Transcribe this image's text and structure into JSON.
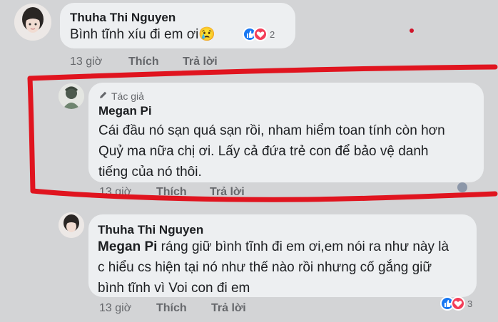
{
  "comments": [
    {
      "author": "Thuha Thi Nguyen",
      "text": "Bình tĩnh xíu đi em ơi😢",
      "reaction_count": "2",
      "time": "13 giờ",
      "like_label": "Thích",
      "reply_label": "Trả lời"
    },
    {
      "badge": "Tác giả",
      "author": "Megan Pi",
      "lines": [
        "Cái đầu nó sạn quá sạn rồi, nham hiểm toan tính còn hơn",
        "Quỷ ma nữa chị ơi. Lấy cả đứa trẻ con để bảo vệ danh",
        "tiếng của nó thôi."
      ],
      "time": "13 giờ",
      "like_label": "Thích",
      "reply_label": "Trả lời"
    },
    {
      "author": "Thuha Thi Nguyen",
      "mention": "Megan Pi",
      "line1_rest": " ráng giữ bình tĩnh đi em ơi,em nói ra như này là",
      "lines": [
        "c hiểu cs hiện tại nó như thế nào rồi nhưng cố gắng giữ",
        "bình tĩnh vì Voi con đi em"
      ],
      "reaction_count": "3",
      "time": "13 giờ",
      "like_label": "Thích",
      "reply_label": "Trả lời"
    }
  ],
  "icons": [
    "like-icon",
    "love-icon",
    "pencil-icon"
  ],
  "colors": {
    "highlight": "#e0141f",
    "like": "#1877f2",
    "love": "#f33e58"
  }
}
